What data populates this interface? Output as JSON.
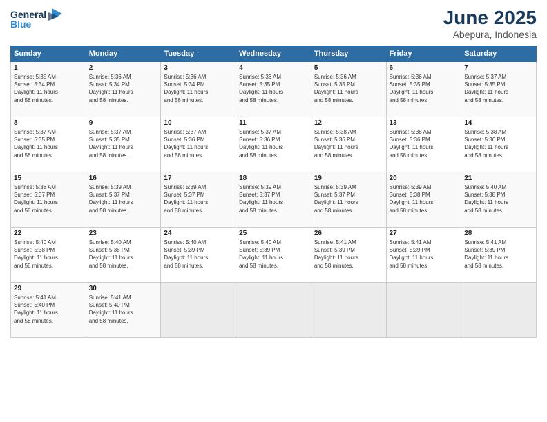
{
  "logo": {
    "line1": "General",
    "line2": "Blue"
  },
  "title": "June 2025",
  "subtitle": "Abepura, Indonesia",
  "days_of_week": [
    "Sunday",
    "Monday",
    "Tuesday",
    "Wednesday",
    "Thursday",
    "Friday",
    "Saturday"
  ],
  "weeks": [
    [
      {
        "day": 1,
        "lines": [
          "Sunrise: 5:35 AM",
          "Sunset: 5:34 PM",
          "Daylight: 11 hours",
          "and 58 minutes."
        ]
      },
      {
        "day": 2,
        "lines": [
          "Sunrise: 5:36 AM",
          "Sunset: 5:34 PM",
          "Daylight: 11 hours",
          "and 58 minutes."
        ]
      },
      {
        "day": 3,
        "lines": [
          "Sunrise: 5:36 AM",
          "Sunset: 5:34 PM",
          "Daylight: 11 hours",
          "and 58 minutes."
        ]
      },
      {
        "day": 4,
        "lines": [
          "Sunrise: 5:36 AM",
          "Sunset: 5:35 PM",
          "Daylight: 11 hours",
          "and 58 minutes."
        ]
      },
      {
        "day": 5,
        "lines": [
          "Sunrise: 5:36 AM",
          "Sunset: 5:35 PM",
          "Daylight: 11 hours",
          "and 58 minutes."
        ]
      },
      {
        "day": 6,
        "lines": [
          "Sunrise: 5:36 AM",
          "Sunset: 5:35 PM",
          "Daylight: 11 hours",
          "and 58 minutes."
        ]
      },
      {
        "day": 7,
        "lines": [
          "Sunrise: 5:37 AM",
          "Sunset: 5:35 PM",
          "Daylight: 11 hours",
          "and 58 minutes."
        ]
      }
    ],
    [
      {
        "day": 8,
        "lines": [
          "Sunrise: 5:37 AM",
          "Sunset: 5:35 PM",
          "Daylight: 11 hours",
          "and 58 minutes."
        ]
      },
      {
        "day": 9,
        "lines": [
          "Sunrise: 5:37 AM",
          "Sunset: 5:35 PM",
          "Daylight: 11 hours",
          "and 58 minutes."
        ]
      },
      {
        "day": 10,
        "lines": [
          "Sunrise: 5:37 AM",
          "Sunset: 5:36 PM",
          "Daylight: 11 hours",
          "and 58 minutes."
        ]
      },
      {
        "day": 11,
        "lines": [
          "Sunrise: 5:37 AM",
          "Sunset: 5:36 PM",
          "Daylight: 11 hours",
          "and 58 minutes."
        ]
      },
      {
        "day": 12,
        "lines": [
          "Sunrise: 5:38 AM",
          "Sunset: 5:36 PM",
          "Daylight: 11 hours",
          "and 58 minutes."
        ]
      },
      {
        "day": 13,
        "lines": [
          "Sunrise: 5:38 AM",
          "Sunset: 5:36 PM",
          "Daylight: 11 hours",
          "and 58 minutes."
        ]
      },
      {
        "day": 14,
        "lines": [
          "Sunrise: 5:38 AM",
          "Sunset: 5:36 PM",
          "Daylight: 11 hours",
          "and 58 minutes."
        ]
      }
    ],
    [
      {
        "day": 15,
        "lines": [
          "Sunrise: 5:38 AM",
          "Sunset: 5:37 PM",
          "Daylight: 11 hours",
          "and 58 minutes."
        ]
      },
      {
        "day": 16,
        "lines": [
          "Sunrise: 5:39 AM",
          "Sunset: 5:37 PM",
          "Daylight: 11 hours",
          "and 58 minutes."
        ]
      },
      {
        "day": 17,
        "lines": [
          "Sunrise: 5:39 AM",
          "Sunset: 5:37 PM",
          "Daylight: 11 hours",
          "and 58 minutes."
        ]
      },
      {
        "day": 18,
        "lines": [
          "Sunrise: 5:39 AM",
          "Sunset: 5:37 PM",
          "Daylight: 11 hours",
          "and 58 minutes."
        ]
      },
      {
        "day": 19,
        "lines": [
          "Sunrise: 5:39 AM",
          "Sunset: 5:37 PM",
          "Daylight: 11 hours",
          "and 58 minutes."
        ]
      },
      {
        "day": 20,
        "lines": [
          "Sunrise: 5:39 AM",
          "Sunset: 5:38 PM",
          "Daylight: 11 hours",
          "and 58 minutes."
        ]
      },
      {
        "day": 21,
        "lines": [
          "Sunrise: 5:40 AM",
          "Sunset: 5:38 PM",
          "Daylight: 11 hours",
          "and 58 minutes."
        ]
      }
    ],
    [
      {
        "day": 22,
        "lines": [
          "Sunrise: 5:40 AM",
          "Sunset: 5:38 PM",
          "Daylight: 11 hours",
          "and 58 minutes."
        ]
      },
      {
        "day": 23,
        "lines": [
          "Sunrise: 5:40 AM",
          "Sunset: 5:38 PM",
          "Daylight: 11 hours",
          "and 58 minutes."
        ]
      },
      {
        "day": 24,
        "lines": [
          "Sunrise: 5:40 AM",
          "Sunset: 5:39 PM",
          "Daylight: 11 hours",
          "and 58 minutes."
        ]
      },
      {
        "day": 25,
        "lines": [
          "Sunrise: 5:40 AM",
          "Sunset: 5:39 PM",
          "Daylight: 11 hours",
          "and 58 minutes."
        ]
      },
      {
        "day": 26,
        "lines": [
          "Sunrise: 5:41 AM",
          "Sunset: 5:39 PM",
          "Daylight: 11 hours",
          "and 58 minutes."
        ]
      },
      {
        "day": 27,
        "lines": [
          "Sunrise: 5:41 AM",
          "Sunset: 5:39 PM",
          "Daylight: 11 hours",
          "and 58 minutes."
        ]
      },
      {
        "day": 28,
        "lines": [
          "Sunrise: 5:41 AM",
          "Sunset: 5:39 PM",
          "Daylight: 11 hours",
          "and 58 minutes."
        ]
      }
    ],
    [
      {
        "day": 29,
        "lines": [
          "Sunrise: 5:41 AM",
          "Sunset: 5:40 PM",
          "Daylight: 11 hours",
          "and 58 minutes."
        ]
      },
      {
        "day": 30,
        "lines": [
          "Sunrise: 5:41 AM",
          "Sunset: 5:40 PM",
          "Daylight: 11 hours",
          "and 58 minutes."
        ]
      },
      null,
      null,
      null,
      null,
      null
    ]
  ]
}
